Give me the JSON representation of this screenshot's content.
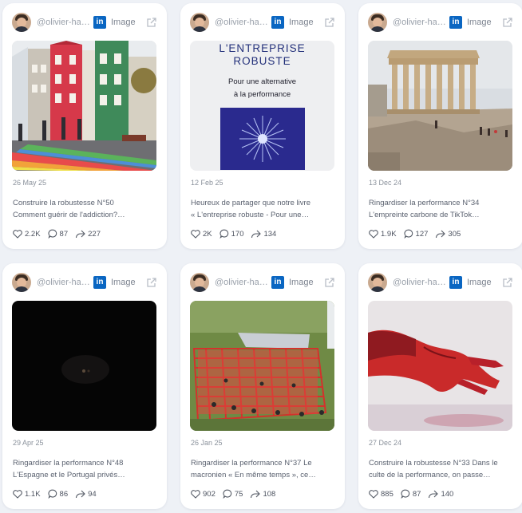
{
  "colors": {
    "background": "#eef1f6",
    "card": "#ffffff",
    "linkedin": "#0a66c2",
    "muted_text": "#8b929c"
  },
  "posts": [
    {
      "handle": "@olivier-ha…",
      "network_icon": "linkedin-icon",
      "type": "Image",
      "date": "26 May 25",
      "line1": "Construire la robustesse N°50",
      "line2": "Comment guérir de l'addiction?…",
      "likes": "2.2K",
      "comments": "87",
      "shares": "227",
      "image_subject": "colorful-houses-rainbow-street"
    },
    {
      "handle": "@olivier-ha…",
      "network_icon": "linkedin-icon",
      "type": "Image",
      "date": "12 Feb 25",
      "line1": "Heureux de partager que notre livre",
      "line2": "« L'entreprise robuste - Pour une…",
      "likes": "2K",
      "comments": "170",
      "shares": "134",
      "image_subject": "book-cover",
      "cover": {
        "title_line1": "L'ENTREPRISE",
        "title_line2": "ROBUSTE",
        "subtitle_line1": "Pour une alternative",
        "subtitle_line2": "à la performance"
      }
    },
    {
      "handle": "@olivier-ha…",
      "network_icon": "linkedin-icon",
      "type": "Image",
      "date": "13 Dec 24",
      "line1": "Ringardiser la performance N°34",
      "line2": "L'empreinte carbone de TikTok…",
      "likes": "1.9K",
      "comments": "127",
      "shares": "305",
      "image_subject": "parthenon-ruins"
    },
    {
      "handle": "@olivier-ha…",
      "network_icon": "linkedin-icon",
      "type": "Image",
      "date": "29 Apr 25",
      "line1": "Ringardiser la performance N°48",
      "line2": "L'Espagne et le Portugal privés…",
      "likes": "1.1K",
      "comments": "86",
      "shares": "94",
      "image_subject": "dark-blackout-scene"
    },
    {
      "handle": "@olivier-ha…",
      "network_icon": "linkedin-icon",
      "type": "Image",
      "date": "26 Jan 25",
      "line1": "Ringardiser la performance N°37 Le",
      "line2": "macronien « En même temps », ce…",
      "likes": "902",
      "comments": "75",
      "shares": "108",
      "image_subject": "red-shopping-carts-on-grass"
    },
    {
      "handle": "@olivier-ha…",
      "network_icon": "linkedin-icon",
      "type": "Image",
      "date": "27 Dec 24",
      "line1": "Construire la robustesse N°33 Dans le",
      "line2": "culte de la performance, on passe…",
      "likes": "885",
      "comments": "87",
      "shares": "140",
      "image_subject": "hand-covered-in-red-paint"
    }
  ]
}
